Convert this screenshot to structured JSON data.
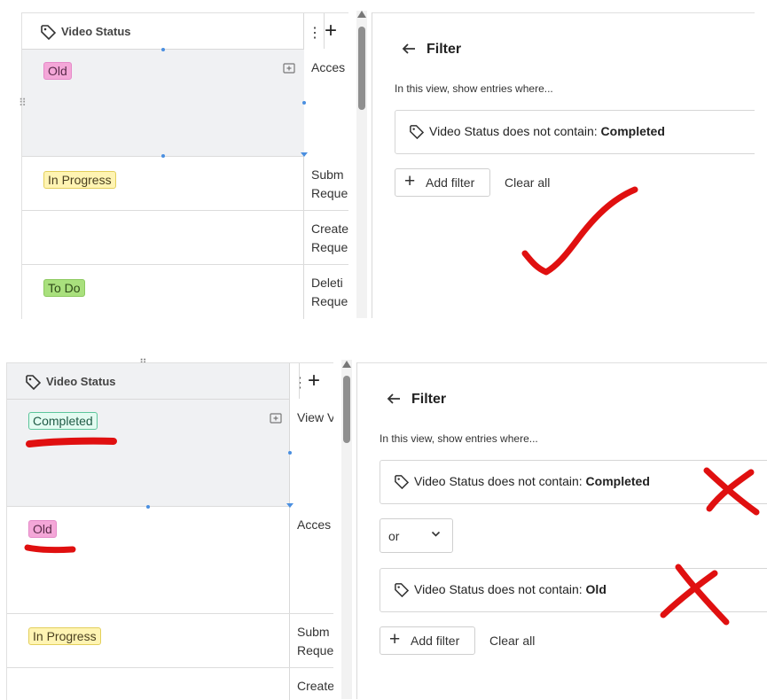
{
  "top": {
    "table": {
      "column_header": "Video Status",
      "add_column_symbol": "+",
      "rows": [
        {
          "tag": "Old",
          "next_col": [
            "Acces"
          ]
        },
        {
          "tag": "In Progress",
          "next_col": [
            "Subm",
            "Reque"
          ]
        },
        {
          "tag": "",
          "next_col": [
            "Create",
            "Reque"
          ]
        },
        {
          "tag": "To Do",
          "next_col": [
            "Deleti",
            "Reque"
          ]
        }
      ]
    },
    "filter": {
      "title": "Filter",
      "subtitle": "In this view, show entries where...",
      "conditions": [
        {
          "prefix": "Video Status does not contain: ",
          "value": "Completed"
        }
      ],
      "add_filter_label": "Add filter",
      "clear_all_label": "Clear all"
    },
    "annotation": "checkmark"
  },
  "bottom": {
    "table": {
      "column_header": "Video Status",
      "add_column_symbol": "+",
      "rows": [
        {
          "tag": "Completed",
          "next_col": [
            "View V"
          ]
        },
        {
          "tag": "Old",
          "next_col": [
            "Acces"
          ]
        },
        {
          "tag": "In Progress",
          "next_col": [
            "Subm",
            "Reque"
          ]
        },
        {
          "tag": "",
          "next_col": [
            "Create"
          ]
        }
      ]
    },
    "filter": {
      "title": "Filter",
      "subtitle": "In this view, show entries where...",
      "conditions": [
        {
          "prefix": "Video Status does not contain: ",
          "value": "Completed"
        },
        {
          "prefix": "Video Status does not contain: ",
          "value": "Old"
        }
      ],
      "conjunction": "or",
      "add_filter_label": "Add filter",
      "clear_all_label": "Clear all"
    },
    "annotations": [
      "underline-completed",
      "underline-old",
      "cross-1",
      "cross-2"
    ]
  },
  "colors": {
    "annotation_red": "#e01010",
    "tag_old": "#f4a7d8",
    "tag_in_progress": "#fff4b3",
    "tag_to_do": "#a9e07d",
    "tag_completed": "#e3fbf1"
  }
}
